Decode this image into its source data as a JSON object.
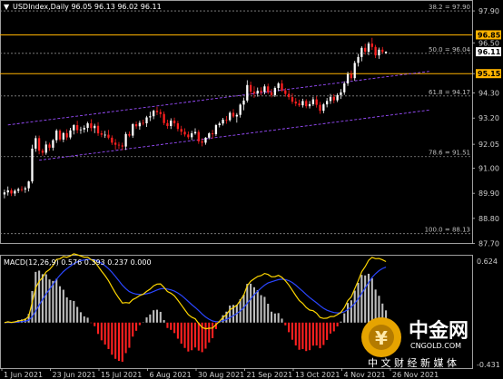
{
  "header": {
    "symbol_line": "USDIndex,Daily  96.05 96.13 96.02 96.11"
  },
  "colors": {
    "background": "#000000",
    "axis": "#bfbfbf",
    "bull": "#ffffff",
    "bear": "#ff2020",
    "resistance": "#ffb300",
    "channel": "#9a4dff",
    "macd_line": "#ffd700",
    "signal_line": "#2a46ff",
    "hist_pos": "#bdbdbd",
    "hist_neg": "#ff2020",
    "price_tag_bg": "#ffffff"
  },
  "chart_data": [
    {
      "type": "candlestick",
      "title": "USDIndex,Daily",
      "ylim": [
        87.72,
        98.3
      ],
      "y_ticks": [
        "97.90",
        "96.50",
        "95.15",
        "94.30",
        "93.20",
        "92.05",
        "91.00",
        "89.90",
        "88.80",
        "87.70"
      ],
      "x_ticks": [
        "1 Jun 2021",
        "23 Jun 2021",
        "15 Jul 2021",
        "6 Aug 2021",
        "30 Aug 2021",
        "21 Sep 2021",
        "13 Oct 2021",
        "4 Nov 2021",
        "26 Nov 2021"
      ],
      "current_price": "96.11",
      "price_tags": [
        {
          "label": "96.85",
          "value": 96.85,
          "color": "#ffb300"
        },
        {
          "label": "96.11",
          "value": 96.11,
          "color": "#ffffff"
        },
        {
          "label": "95.15",
          "value": 95.15,
          "color": "#ffb300"
        }
      ],
      "horizontal_lines": [
        {
          "value": 96.85,
          "style": "solid",
          "color": "#ffb300"
        },
        {
          "value": 95.15,
          "style": "solid",
          "color": "#ffb300"
        }
      ],
      "fib_levels": [
        {
          "label": "38.2 = 97.90",
          "value": 97.9
        },
        {
          "label": "50.0 = 96.04",
          "value": 96.04
        },
        {
          "label": "61.8 = 94.17",
          "value": 94.17
        },
        {
          "label": "78.6 = 91.51",
          "value": 91.51
        },
        {
          "label": "100.0 = 88.13",
          "value": 88.13
        }
      ],
      "channel": {
        "upper": [
          [
            1,
            92.9
          ],
          [
            112,
            95.25
          ]
        ],
        "lower": [
          [
            10,
            91.35
          ],
          [
            112,
            93.55
          ]
        ]
      },
      "ohlc": [
        [
          89.85,
          90.06,
          89.68,
          89.94
        ],
        [
          89.94,
          90.2,
          89.8,
          90.03
        ],
        [
          90.03,
          90.12,
          89.78,
          89.89
        ],
        [
          89.89,
          90.08,
          89.78,
          90.01
        ],
        [
          90.01,
          90.15,
          89.91,
          90.08
        ],
        [
          90.08,
          90.21,
          89.97,
          90.07
        ],
        [
          90.07,
          90.2,
          89.92,
          90.12
        ],
        [
          90.12,
          90.45,
          89.98,
          90.42
        ],
        [
          90.42,
          92.03,
          90.33,
          91.86
        ],
        [
          91.86,
          92.43,
          91.72,
          92.32
        ],
        [
          92.32,
          92.43,
          91.61,
          91.77
        ],
        [
          91.77,
          91.86,
          91.55,
          91.68
        ],
        [
          91.68,
          92.19,
          91.59,
          92.04
        ],
        [
          92.04,
          92.12,
          91.76,
          91.9
        ],
        [
          91.9,
          92.28,
          91.77,
          92.23
        ],
        [
          92.23,
          92.72,
          92.11,
          92.65
        ],
        [
          92.65,
          92.71,
          92.18,
          92.26
        ],
        [
          92.26,
          92.59,
          92.14,
          92.54
        ],
        [
          92.54,
          92.71,
          92.23,
          92.35
        ],
        [
          92.35,
          92.77,
          92.27,
          92.66
        ],
        [
          92.66,
          92.93,
          92.48,
          92.89
        ],
        [
          92.89,
          93.08,
          92.53,
          92.67
        ],
        [
          92.67,
          92.82,
          92.51,
          92.7
        ],
        [
          92.7,
          92.88,
          92.56,
          92.77
        ],
        [
          92.77,
          93.04,
          92.59,
          92.97
        ],
        [
          92.97,
          93.15,
          92.62,
          92.76
        ],
        [
          92.76,
          92.95,
          92.54,
          92.86
        ],
        [
          92.86,
          93.02,
          92.42,
          92.53
        ],
        [
          92.53,
          92.65,
          92.36,
          92.47
        ],
        [
          92.47,
          92.64,
          92.33,
          92.47
        ],
        [
          92.47,
          92.68,
          92.27,
          92.34
        ],
        [
          92.34,
          92.44,
          92.02,
          92.12
        ],
        [
          92.12,
          92.28,
          91.82,
          92.03
        ],
        [
          92.03,
          92.15,
          91.84,
          92.0
        ],
        [
          92.0,
          92.12,
          91.79,
          91.95
        ],
        [
          91.95,
          92.59,
          91.8,
          92.5
        ],
        [
          92.5,
          92.61,
          92.36,
          92.43
        ],
        [
          92.43,
          92.98,
          92.33,
          92.93
        ],
        [
          92.93,
          93.05,
          92.73,
          92.84
        ],
        [
          92.84,
          93.09,
          92.69,
          92.99
        ],
        [
          92.99,
          93.13,
          92.88,
          92.97
        ],
        [
          92.97,
          93.3,
          92.81,
          93.23
        ],
        [
          93.23,
          93.48,
          93.07,
          93.28
        ],
        [
          93.28,
          93.57,
          93.15,
          93.52
        ],
        [
          93.52,
          93.69,
          93.33,
          93.46
        ],
        [
          93.46,
          93.59,
          93.22,
          93.38
        ],
        [
          93.38,
          93.49,
          92.89,
          92.98
        ],
        [
          92.98,
          93.13,
          92.73,
          92.85
        ],
        [
          92.85,
          93.19,
          92.72,
          93.09
        ],
        [
          93.09,
          93.22,
          92.83,
          92.97
        ],
        [
          92.97,
          93.08,
          92.61,
          92.72
        ],
        [
          92.72,
          92.86,
          92.45,
          92.6
        ],
        [
          92.6,
          92.75,
          92.39,
          92.48
        ],
        [
          92.48,
          92.61,
          92.27,
          92.36
        ],
        [
          92.36,
          92.64,
          92.24,
          92.53
        ],
        [
          92.53,
          92.75,
          92.47,
          92.59
        ],
        [
          92.59,
          92.68,
          92.07,
          92.18
        ],
        [
          92.18,
          92.31,
          91.96,
          92.12
        ],
        [
          92.12,
          92.37,
          92.03,
          92.34
        ],
        [
          92.34,
          92.58,
          92.27,
          92.53
        ],
        [
          92.53,
          92.68,
          92.29,
          92.49
        ],
        [
          92.49,
          92.94,
          92.41,
          92.89
        ],
        [
          92.89,
          93.04,
          92.79,
          92.96
        ],
        [
          92.96,
          93.21,
          92.87,
          93.13
        ],
        [
          93.13,
          93.29,
          92.95,
          93.11
        ],
        [
          93.11,
          93.5,
          93.04,
          93.43
        ],
        [
          93.43,
          93.59,
          93.21,
          93.27
        ],
        [
          93.27,
          93.42,
          93.0,
          93.34
        ],
        [
          93.34,
          93.84,
          93.22,
          93.79
        ],
        [
          93.79,
          94.1,
          93.54,
          93.97
        ],
        [
          93.97,
          94.86,
          93.88,
          94.65
        ],
        [
          94.65,
          94.8,
          94.22,
          94.36
        ],
        [
          94.36,
          94.59,
          94.09,
          94.28
        ],
        [
          94.28,
          94.54,
          94.14,
          94.4
        ],
        [
          94.4,
          94.55,
          94.2,
          94.34
        ],
        [
          94.34,
          94.68,
          94.24,
          94.59
        ],
        [
          94.59,
          94.71,
          94.25,
          94.33
        ],
        [
          94.33,
          94.48,
          94.11,
          94.2
        ],
        [
          94.2,
          94.59,
          94.13,
          94.52
        ],
        [
          94.52,
          94.78,
          94.38,
          94.72
        ],
        [
          94.72,
          94.87,
          94.35,
          94.41
        ],
        [
          94.41,
          94.52,
          94.14,
          94.26
        ],
        [
          94.26,
          94.43,
          94.01,
          94.12
        ],
        [
          94.12,
          94.29,
          93.82,
          93.92
        ],
        [
          93.92,
          94.08,
          93.72,
          93.84
        ],
        [
          93.84,
          94.01,
          93.69,
          93.76
        ],
        [
          93.76,
          94.05,
          93.66,
          93.95
        ],
        [
          93.95,
          94.03,
          93.63,
          93.72
        ],
        [
          93.72,
          93.95,
          93.62,
          93.81
        ],
        [
          93.81,
          94.13,
          93.73,
          94.02
        ],
        [
          94.02,
          94.16,
          93.66,
          93.78
        ],
        [
          93.78,
          93.91,
          93.39,
          93.52
        ],
        [
          93.52,
          93.86,
          93.41,
          93.8
        ],
        [
          93.8,
          94.08,
          93.67,
          93.95
        ],
        [
          93.95,
          94.26,
          93.82,
          94.13
        ],
        [
          94.13,
          94.25,
          93.85,
          93.98
        ],
        [
          93.98,
          94.29,
          93.9,
          94.21
        ],
        [
          94.21,
          94.47,
          94.04,
          94.33
        ],
        [
          94.33,
          94.81,
          94.22,
          94.72
        ],
        [
          94.72,
          95.23,
          94.61,
          95.13
        ],
        [
          95.13,
          95.29,
          94.86,
          94.95
        ],
        [
          94.95,
          95.71,
          94.84,
          95.62
        ],
        [
          95.62,
          96.02,
          95.46,
          95.88
        ],
        [
          95.88,
          96.35,
          95.69,
          96.28
        ],
        [
          96.28,
          96.46,
          95.98,
          96.11
        ],
        [
          96.11,
          96.55,
          95.96,
          96.47
        ],
        [
          96.47,
          96.72,
          96.19,
          96.32
        ],
        [
          96.32,
          96.41,
          95.83,
          95.95
        ],
        [
          95.95,
          96.29,
          95.8,
          96.2
        ],
        [
          96.2,
          96.32,
          96.02,
          96.1
        ],
        [
          96.05,
          96.13,
          96.02,
          96.11
        ]
      ]
    },
    {
      "type": "macd",
      "title": "MACD(12,26,9) 0.576 0.393 0.237 0.000",
      "params": "12,26,9",
      "values": {
        "macd": 0.576,
        "signal": 0.393,
        "histogram": 0.237,
        "other": 0.0
      },
      "ylim": [
        -0.431,
        0.624
      ],
      "y_ticks": [
        "0.624",
        "-0.431"
      ]
    }
  ],
  "watermark": {
    "cn_title": "中金网",
    "domain": "CNGOLD.COM",
    "subtitle": "中 文 财 经 新 媒 体"
  }
}
